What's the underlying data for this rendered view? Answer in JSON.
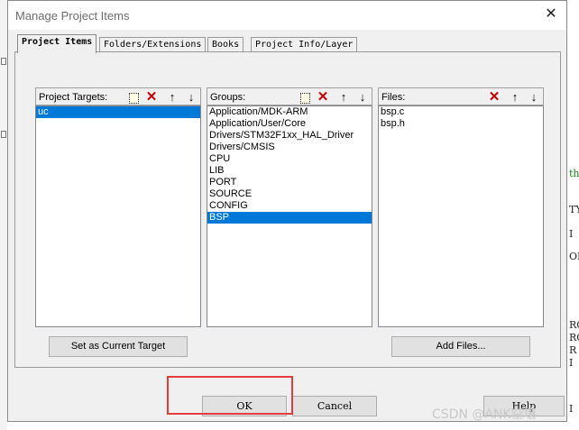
{
  "dialog": {
    "title": "Manage Project Items",
    "close_glyph": "✕"
  },
  "tabs": [
    {
      "label": "Project Items",
      "active": true
    },
    {
      "label": "Folders/Extensions",
      "active": false
    },
    {
      "label": "Books",
      "active": false
    },
    {
      "label": "Project Info/Layer",
      "active": false
    }
  ],
  "targets": {
    "header": "Project Targets:",
    "items": [
      "uc"
    ],
    "selected": "uc"
  },
  "groups": {
    "header": "Groups:",
    "items": [
      "Application/MDK-ARM",
      "Application/User/Core",
      "Drivers/STM32F1xx_HAL_Driver",
      "Drivers/CMSIS",
      "CPU",
      "LIB",
      "PORT",
      "SOURCE",
      "CONFIG",
      "BSP"
    ],
    "selected": "BSP"
  },
  "files": {
    "header": "Files:",
    "items": [
      "bsp.c",
      "bsp.h"
    ]
  },
  "buttons": {
    "set_current_target": "Set as Current Target",
    "add_files": "Add Files...",
    "ok": "OK",
    "cancel": "Cancel",
    "help": "Help"
  },
  "icons": {
    "new": "new-item-icon",
    "delete": "delete-icon",
    "move_up": "arrow-up-icon",
    "move_down": "arrow-down-icon",
    "delete_color": "#c00000",
    "selection_color": "#0078d7",
    "highlight_color": "#e23c3c"
  },
  "watermark": "CSDN @ANK空壤"
}
